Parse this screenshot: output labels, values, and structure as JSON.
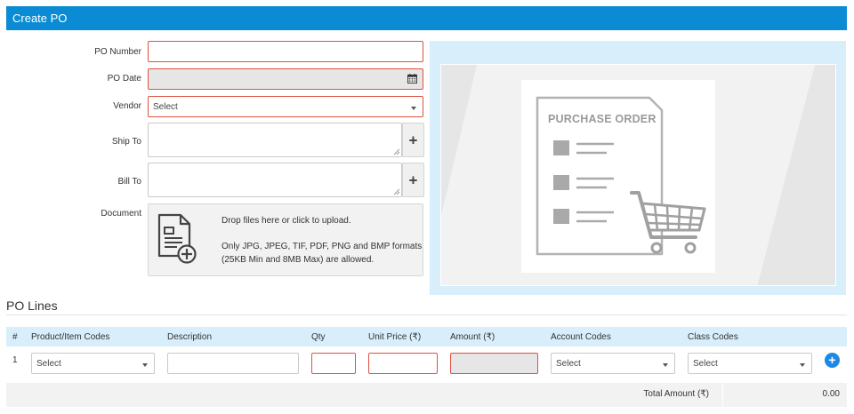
{
  "header": {
    "title": "Create PO"
  },
  "form": {
    "po_number_label": "PO Number",
    "po_date_label": "PO Date",
    "vendor_label": "Vendor",
    "vendor_value": "Select",
    "ship_to_label": "Ship To",
    "bill_to_label": "Bill To",
    "document_label": "Document",
    "add_symbol": "+",
    "upload": {
      "line1": "Drop files here or click to upload.",
      "line2": "Only JPG, JPEG, TIF, PDF, PNG and BMP formats",
      "line3": "(25KB Min and 8MB Max) are allowed."
    }
  },
  "preview": {
    "title": "PURCHASE ORDER"
  },
  "icons": {
    "calendar": "calendar-icon",
    "document_add": "document-add-icon",
    "cart": "shopping-cart-icon",
    "plus_circle": "plus-circle-icon"
  },
  "lines": {
    "section_title": "PO Lines",
    "columns": [
      "#",
      "Product/Item Codes",
      "Description",
      "Qty",
      "Unit Price (₹)",
      "Amount (₹)",
      "Account Codes",
      "Class Codes"
    ],
    "row": {
      "number": "1",
      "product": "Select",
      "account": "Select",
      "class": "Select"
    },
    "add_symbol": "+",
    "total_label": "Total Amount (₹)",
    "total_value": "0.00"
  },
  "colors": {
    "header_bg": "#0a8bd3",
    "required_border": "#e0513f",
    "table_header_bg": "#d8eefb",
    "accent_blue": "#1e88e5"
  }
}
